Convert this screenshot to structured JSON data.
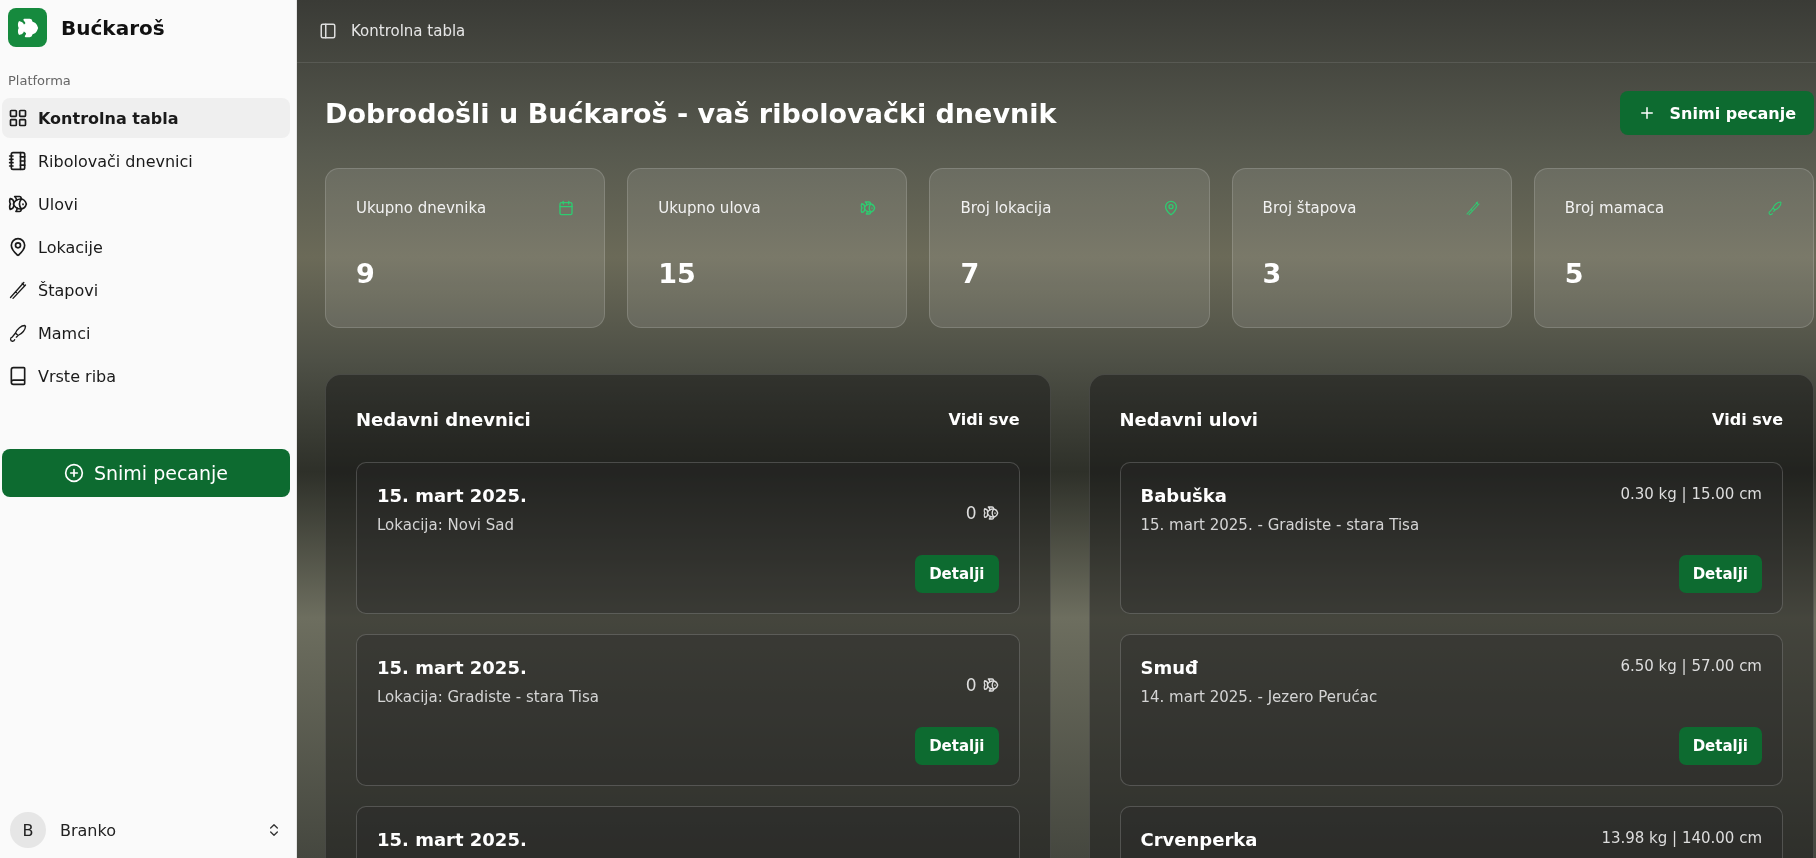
{
  "app": {
    "name": "Bućkaroš"
  },
  "sidebar": {
    "section_label": "Platforma",
    "items": [
      {
        "label": "Kontrolna tabla",
        "kind": "grid",
        "selected": true
      },
      {
        "label": "Ribolovači dnevnici",
        "kind": "notebook",
        "selected": false
      },
      {
        "label": "Ulovi",
        "kind": "fish",
        "selected": false
      },
      {
        "label": "Lokacije",
        "kind": "pin",
        "selected": false
      },
      {
        "label": "Štapovi",
        "kind": "rod",
        "selected": false
      },
      {
        "label": "Mamci",
        "kind": "bait",
        "selected": false
      },
      {
        "label": "Vrste riba",
        "kind": "book",
        "selected": false
      }
    ],
    "action_button": "Snimi pecanje",
    "user": {
      "initial": "B",
      "name": "Branko"
    }
  },
  "topbar": {
    "breadcrumb": "Kontrolna tabla"
  },
  "header": {
    "title": "Dobrodošli u Bućkaroš - vaš ribolovački dnevnik",
    "action_button": "Snimi pecanje"
  },
  "stats": [
    {
      "label": "Ukupno dnevnika",
      "value": "9",
      "kind": "calendar"
    },
    {
      "label": "Ukupno ulova",
      "value": "15",
      "kind": "fish"
    },
    {
      "label": "Broj lokacija",
      "value": "7",
      "kind": "pin"
    },
    {
      "label": "Broj štapova",
      "value": "3",
      "kind": "rod"
    },
    {
      "label": "Broj mamaca",
      "value": "5",
      "kind": "bait"
    }
  ],
  "recent_journals": {
    "title": "Nedavni dnevnici",
    "link": "Vidi sve",
    "items": [
      {
        "date": "15. mart 2025.",
        "location": "Lokacija: Novi Sad",
        "count": "0",
        "button": "Detalji"
      },
      {
        "date": "15. mart 2025.",
        "location": "Lokacija: Gradiste - stara Tisa",
        "count": "0",
        "button": "Detalji"
      },
      {
        "date": "15. mart 2025."
      }
    ]
  },
  "recent_catches": {
    "title": "Nedavni ulovi",
    "link": "Vidi sve",
    "items": [
      {
        "species": "Babuška",
        "measure": "0.30 kg | 15.00 cm",
        "detail": "15. mart 2025. - Gradiste - stara Tisa",
        "button": "Detalji"
      },
      {
        "species": "Smuđ",
        "measure": "6.50 kg | 57.00 cm",
        "detail": "14. mart 2025. - Jezero Perućac",
        "button": "Detalji"
      },
      {
        "species": "Crvenperka",
        "measure": "13.98 kg | 140.00 cm"
      }
    ]
  }
}
